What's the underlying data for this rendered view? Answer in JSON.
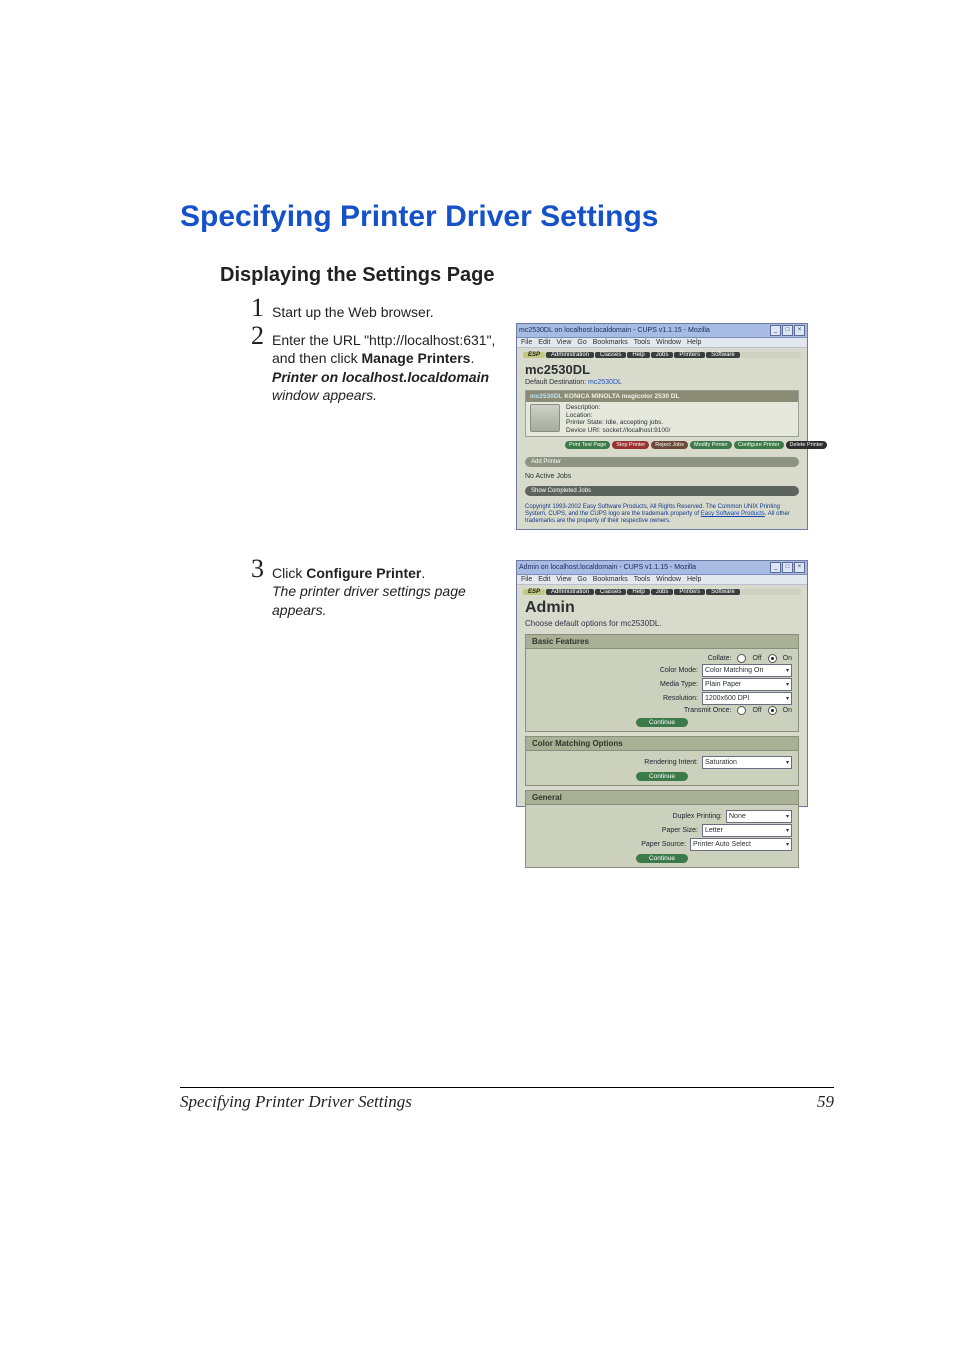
{
  "page": {
    "main_title": "Specifying Printer Driver Settings",
    "subheading": "Displaying the Settings Page",
    "footer_title": "Specifying Printer Driver Settings",
    "page_number": "59"
  },
  "steps": {
    "s1": {
      "num": "1",
      "text": "Start up the Web browser."
    },
    "s2": {
      "num": "2",
      "text_pre": "Enter the URL \"http://localhost:631\", and then click ",
      "bold": "Manage Printers",
      "text_post": ".",
      "ital_boldpart": "Printer on localhost.localdomain",
      "ital_rest": " window appears."
    },
    "s3": {
      "num": "3",
      "text_pre": "Click ",
      "bold": "Configure Printer",
      "text_post": ".",
      "ital": "The printer driver settings page appears."
    }
  },
  "screenshot1": {
    "title": "mc2530DL on localhost.localdomain - CUPS v1.1.15 - Mozilla",
    "menus": [
      "File",
      "Edit",
      "View",
      "Go",
      "Bookmarks",
      "Tools",
      "Window",
      "Help"
    ],
    "nav": [
      "ESP",
      "Administration",
      "Classes",
      "Help",
      "Jobs",
      "Printers",
      "Software"
    ],
    "printer_heading": "mc2530DL",
    "default_dest_label": "Default Destination: ",
    "default_dest_value": "mc2530DL",
    "banner_title_link": "mc2530DL",
    "banner_title_rest": " KONICA MINOLTA magicolor 2530 DL",
    "info": {
      "desc_label": "Description:",
      "loc_label": "Location:",
      "state": "Printer State: Idle, accepting jobs.",
      "uri": "Device URI: socket://localhost:9100/"
    },
    "pills": [
      "Print Test Page",
      "Stop Printer",
      "Reject Jobs",
      "Modify Printer",
      "Configure Printer",
      "Delete Printer"
    ],
    "add_printer_btn": "Add Printer",
    "no_jobs": "No Active Jobs",
    "show_completed_btn": "Show Completed Jobs",
    "copyright": "Copyright 1993-2002 Easy Software Products, All Rights Reserved. The Common UNIX Printing System, CUPS, and the CUPS logo are the trademark property of ",
    "copyright_link": "Easy Software Products",
    "copyright_tail": ". All other trademarks are the property of their respective owners."
  },
  "screenshot2": {
    "title": "Admin on localhost.localdomain - CUPS v1.1.15 - Mozilla",
    "menus": [
      "File",
      "Edit",
      "View",
      "Go",
      "Bookmarks",
      "Tools",
      "Window",
      "Help"
    ],
    "nav": [
      "ESP",
      "Administration",
      "Classes",
      "Help",
      "Jobs",
      "Printers",
      "Software"
    ],
    "admin_heading": "Admin",
    "choose_line": "Choose default options for mc2530DL.",
    "sections": {
      "basic": {
        "title": "Basic Features",
        "collate_label": "Collate:",
        "collate_off": "Off",
        "collate_on": "On",
        "colormode_label": "Color Mode:",
        "colormode_val": "Color Matching On",
        "mediatype_label": "Media Type:",
        "mediatype_val": "Plain Paper",
        "resolution_label": "Resolution:",
        "resolution_val": "1200x600 DPI",
        "transmit_label": "Transmit Once:",
        "transmit_off": "Off",
        "transmit_on": "On",
        "continue_btn": "Continue"
      },
      "color": {
        "title": "Color Matching Options",
        "intent_label": "Rendering Intent:",
        "intent_val": "Saturation",
        "continue_btn": "Continue"
      },
      "general": {
        "title": "General",
        "duplex_label": "Duplex Printing:",
        "duplex_val": "None",
        "paper_size_label": "Paper Size:",
        "paper_size_val": "Letter",
        "paper_source_label": "Paper Source:",
        "paper_source_val": "Printer Auto Select",
        "continue_btn": "Continue"
      }
    }
  }
}
